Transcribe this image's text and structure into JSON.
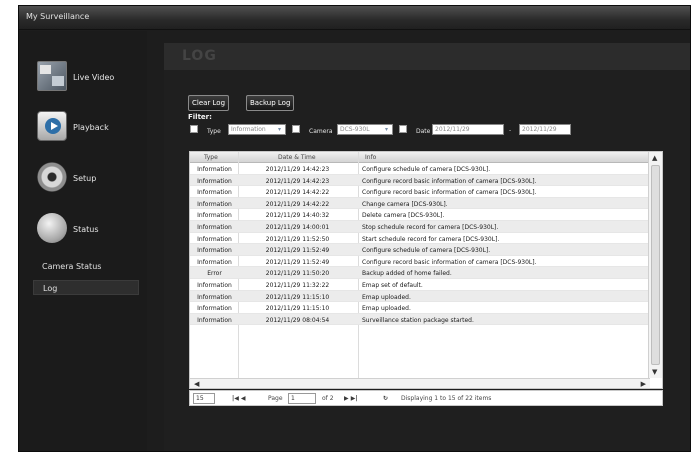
{
  "app": {
    "title": "My Surveillance"
  },
  "sidebar": {
    "items": [
      {
        "label": "Live Video",
        "icon": "live-video-icon"
      },
      {
        "label": "Playback",
        "icon": "playback-icon"
      },
      {
        "label": "Setup",
        "icon": "gear-icon"
      },
      {
        "label": "Status",
        "icon": "status-icon"
      }
    ],
    "subitems": [
      {
        "label": "Camera Status"
      },
      {
        "label": "Log"
      }
    ]
  },
  "main": {
    "title": "LOG",
    "buttons": {
      "clear": "Clear Log",
      "backup": "Backup Log"
    },
    "filter": {
      "label": "Filter:",
      "type_label": "Type",
      "type_value": "Information",
      "camera_label": "Camera",
      "camera_value": "DCS-930L",
      "date_label": "Date",
      "date_from": "2012/11/29",
      "date_sep": "-",
      "date_to": "2012/11/29"
    },
    "grid": {
      "columns": [
        "Type",
        "Date & Time",
        "Info"
      ],
      "rows": [
        {
          "type": "Information",
          "datetime": "2012/11/29 14:42:23",
          "info": "Configure schedule of camera [DCS-930L]."
        },
        {
          "type": "Information",
          "datetime": "2012/11/29 14:42:23",
          "info": "Configure record basic information of camera [DCS-930L]."
        },
        {
          "type": "Information",
          "datetime": "2012/11/29 14:42:22",
          "info": "Configure record basic information of camera [DCS-930L]."
        },
        {
          "type": "Information",
          "datetime": "2012/11/29 14:42:22",
          "info": "Change camera [DCS-930L]."
        },
        {
          "type": "Information",
          "datetime": "2012/11/29 14:40:32",
          "info": "Delete camera [DCS-930L]."
        },
        {
          "type": "Information",
          "datetime": "2012/11/29 14:00:01",
          "info": "Stop schedule record for camera [DCS-930L]."
        },
        {
          "type": "Information",
          "datetime": "2012/11/29 11:52:50",
          "info": "Start schedule record for camera [DCS-930L]."
        },
        {
          "type": "Information",
          "datetime": "2012/11/29 11:52:49",
          "info": "Configure schedule of camera [DCS-930L]."
        },
        {
          "type": "Information",
          "datetime": "2012/11/29 11:52:49",
          "info": "Configure record basic information of camera [DCS-930L]."
        },
        {
          "type": "Error",
          "datetime": "2012/11/29 11:50:20",
          "info": "Backup added of home failed."
        },
        {
          "type": "Information",
          "datetime": "2012/11/29 11:32:22",
          "info": "Emap set of default."
        },
        {
          "type": "Information",
          "datetime": "2012/11/29 11:15:10",
          "info": "Emap uploaded."
        },
        {
          "type": "Information",
          "datetime": "2012/11/29 11:15:10",
          "info": "Emap uploaded."
        },
        {
          "type": "Information",
          "datetime": "2012/11/29 08:04:54",
          "info": "Surveillance station package started."
        }
      ]
    },
    "pager": {
      "page_size": "15",
      "first_prev": "|◀ ◀",
      "page_label": "Page",
      "page_value": "1",
      "of_label": "of 2",
      "next_last": "▶ ▶|",
      "refresh": "↻",
      "display": "Displaying 1 to 15 of 22 items"
    }
  }
}
